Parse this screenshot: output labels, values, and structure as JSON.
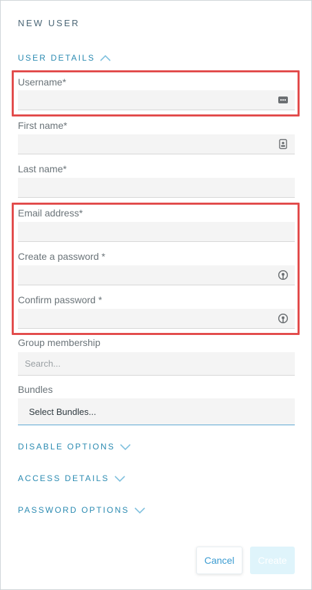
{
  "page": {
    "title": "NEW USER"
  },
  "sections": {
    "user_details": "USER DETAILS",
    "disable_options": "DISABLE OPTIONS",
    "access_details": "ACCESS DETAILS",
    "password_options": "PASSWORD OPTIONS"
  },
  "fields": {
    "username": {
      "label": "Username*",
      "value": "",
      "icon": "more-horiz-icon"
    },
    "first_name": {
      "label": "First name*",
      "value": "",
      "icon": "contact-card-icon"
    },
    "last_name": {
      "label": "Last name*",
      "value": ""
    },
    "email": {
      "label": "Email address*",
      "value": ""
    },
    "password": {
      "label": "Create a password *",
      "value": "",
      "icon": "password-visibility-icon"
    },
    "confirm_password": {
      "label": "Confirm password *",
      "value": "",
      "icon": "password-visibility-icon"
    },
    "group_membership": {
      "label": "Group membership",
      "placeholder": "Search..."
    },
    "bundles": {
      "label": "Bundles",
      "value": "Select Bundles..."
    }
  },
  "buttons": {
    "cancel": "Cancel",
    "create": "Create"
  },
  "colors": {
    "accent": "#2a8ab1",
    "highlight": "#e24b4b",
    "field_bg": "#f4f4f4",
    "create_disabled": "#dff4fb"
  }
}
